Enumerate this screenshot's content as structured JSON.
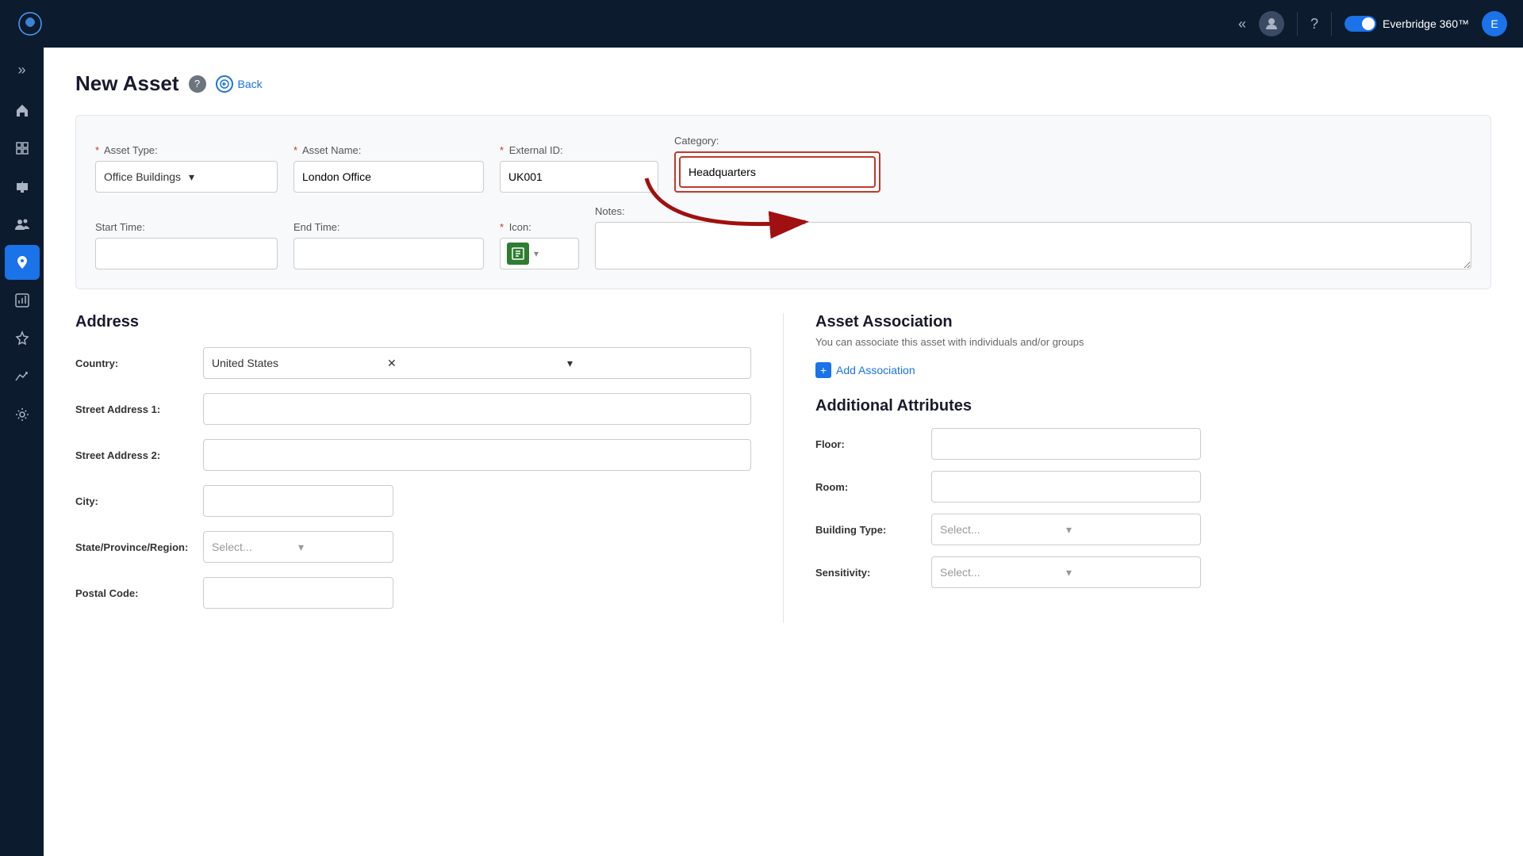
{
  "app": {
    "name": "Everbridge 360™",
    "logo_symbol": "🦋"
  },
  "topnav": {
    "chevron_left": "«",
    "toggle_label": "Everbridge 360™",
    "help_label": "?",
    "user_icon": "👤"
  },
  "sidebar": {
    "toggle": "»",
    "items": [
      {
        "name": "home",
        "icon": "⌂",
        "active": false
      },
      {
        "name": "layers",
        "icon": "⊞",
        "active": false
      },
      {
        "name": "megaphone",
        "icon": "📢",
        "active": false
      },
      {
        "name": "people",
        "icon": "👥",
        "active": false
      },
      {
        "name": "location",
        "icon": "📍",
        "active": true
      },
      {
        "name": "bar-chart",
        "icon": "📊",
        "active": false
      },
      {
        "name": "bolt",
        "icon": "⚡",
        "active": false
      },
      {
        "name": "analytics",
        "icon": "📈",
        "active": false
      },
      {
        "name": "gear",
        "icon": "⚙",
        "active": false
      }
    ]
  },
  "page": {
    "title": "New Asset",
    "back_label": "Back",
    "help_icon": "?"
  },
  "form": {
    "asset_type_label": "Asset Type:",
    "asset_type_required": "*",
    "asset_type_value": "Office Buildings",
    "asset_name_label": "Asset Name:",
    "asset_name_required": "*",
    "asset_name_value": "London Office",
    "external_id_label": "External ID:",
    "external_id_required": "*",
    "external_id_value": "UK001",
    "category_label": "Category:",
    "category_value": "Headquarters",
    "start_time_label": "Start Time:",
    "start_time_value": "",
    "end_time_label": "End Time:",
    "end_time_value": "",
    "icon_label": "Icon:",
    "icon_required": "*",
    "icon_symbol": "▦",
    "notes_label": "Notes:",
    "notes_value": ""
  },
  "address": {
    "section_title": "Address",
    "country_label": "Country:",
    "country_value": "United States",
    "street1_label": "Street Address 1:",
    "street1_value": "",
    "street2_label": "Street Address 2:",
    "street2_value": "",
    "city_label": "City:",
    "city_value": "",
    "state_label": "State/Province/Region:",
    "state_placeholder": "Select...",
    "postal_label": "Postal Code:",
    "postal_value": ""
  },
  "asset_association": {
    "title": "Asset Association",
    "description": "You can associate this asset with individuals and/or groups",
    "add_label": "Add Association"
  },
  "additional_attributes": {
    "title": "Additional Attributes",
    "floor_label": "Floor:",
    "floor_value": "",
    "room_label": "Room:",
    "room_value": "",
    "building_type_label": "Building Type:",
    "building_type_placeholder": "Select...",
    "sensitivity_label": "Sensitivity:",
    "sensitivity_placeholder": "Select..."
  }
}
